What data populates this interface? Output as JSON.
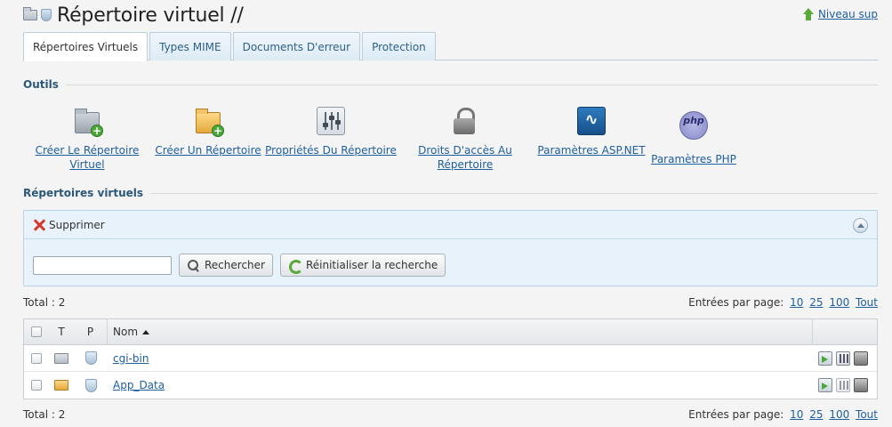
{
  "header": {
    "title": "Répertoire virtuel //",
    "level_up_label": "Niveau sup"
  },
  "tabs": [
    {
      "label": "Répertoires Virtuels",
      "active": true
    },
    {
      "label": "Types MIME",
      "active": false
    },
    {
      "label": "Documents D'erreur",
      "active": false
    },
    {
      "label": "Protection",
      "active": false
    }
  ],
  "tools": {
    "section_title": "Outils",
    "items": [
      {
        "line1": "Créer Le Répertoire",
        "line2": "Virtuel",
        "icon": "folder-add-icon"
      },
      {
        "line1": "Créer Un Répertoire",
        "line2": "",
        "icon": "folder-add-icon"
      },
      {
        "line1": "Propriétés Du Répertoire",
        "line2": "",
        "icon": "properties-icon"
      },
      {
        "line1": "Droits D'accès Au",
        "line2": "Répertoire",
        "icon": "lock-icon"
      },
      {
        "line1": "Paramètres ASP.NET",
        "line2": "",
        "icon": "aspnet-icon"
      },
      {
        "line1": "Paramètres PHP",
        "line2": "",
        "icon": "php-icon"
      }
    ]
  },
  "vdirs": {
    "section_title": "Répertoires virtuels",
    "delete_label": "Supprimer",
    "search_value": "",
    "search_button": "Rechercher",
    "reset_button": "Réinitialiser la recherche",
    "total_label": "Total : 2",
    "per_page_label": "Entrées par page:",
    "per_page_options": [
      "10",
      "25",
      "100",
      "Tout"
    ],
    "columns": {
      "t": "T",
      "p": "P",
      "name": "Nom"
    },
    "rows": [
      {
        "name": "cgi-bin",
        "type": "virtual"
      },
      {
        "name": "App_Data",
        "type": "physical"
      }
    ]
  },
  "colors": {
    "link": "#1f5fa0",
    "section_title": "#2b587a",
    "panel_bg": "#e8f2fa",
    "delete_icon": "#d6382c",
    "level_up_arrow": "#5aa83a"
  }
}
